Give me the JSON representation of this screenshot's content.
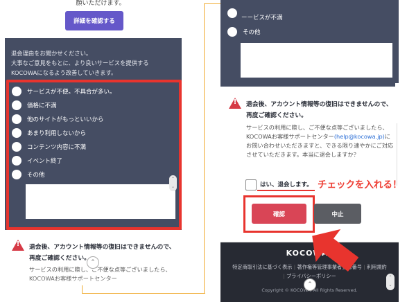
{
  "left": {
    "top_text": "顔いただけます。",
    "detail_button": "詳細を確認する",
    "reason_intro": [
      "退会理由をお聞かせください。",
      "大事なご意見をもとに、より良いサービスを提供する",
      "KOCOWAになるよう改善していきます。"
    ],
    "options": [
      "サービスが不便。不具合が多い。",
      "価格に不満",
      "他のサイトがもっといいから",
      "あまり利用しないから",
      "コンテンツ内容に不満",
      "イベント終了",
      "その他"
    ],
    "warning_title": "退会後、アカウント情報等の復旧はできませんので、再度ご確認ください。",
    "warning_body": "サービスの利用に際し、ご不便な点等ございましたら、KOCOWAお客様サポートセンター"
  },
  "right": {
    "option_partial": "ーービスが不満",
    "option_other": "その他",
    "warning_title": "退会後、アカウント情報等の復旧はできませんので、再度ご確認ください。",
    "warning_body_1": "サービスの利用に際し、ご不便な点等ございましたら、KOCOWAお客様サポートセンター",
    "support_email": "(help@kocowa.jp)",
    "warning_body_2": "にお問い合わせいただきますと、できる限り速やかにご対応させていただきます。本当に退会しますか？",
    "agree_label": "はい、退会します。",
    "callout": "チェックを入れる！",
    "confirm_button": "確認",
    "cancel_button": "中止",
    "footer_logo": "KOCOWA⁺",
    "footer_links": [
      "特定商取引法に基づく表示",
      "著作権等管理事業者登録番号",
      "利用規約",
      "プライバシーポリシー"
    ],
    "copyright": "Copyright © KOCOWA. All Rights Reserved."
  },
  "colors": {
    "dark_panel": "#454d63",
    "accent_purple": "#6558c9",
    "annotation_red": "#e8342e",
    "confirm_red": "#d94556",
    "connector_orange": "#f0aa2d"
  }
}
